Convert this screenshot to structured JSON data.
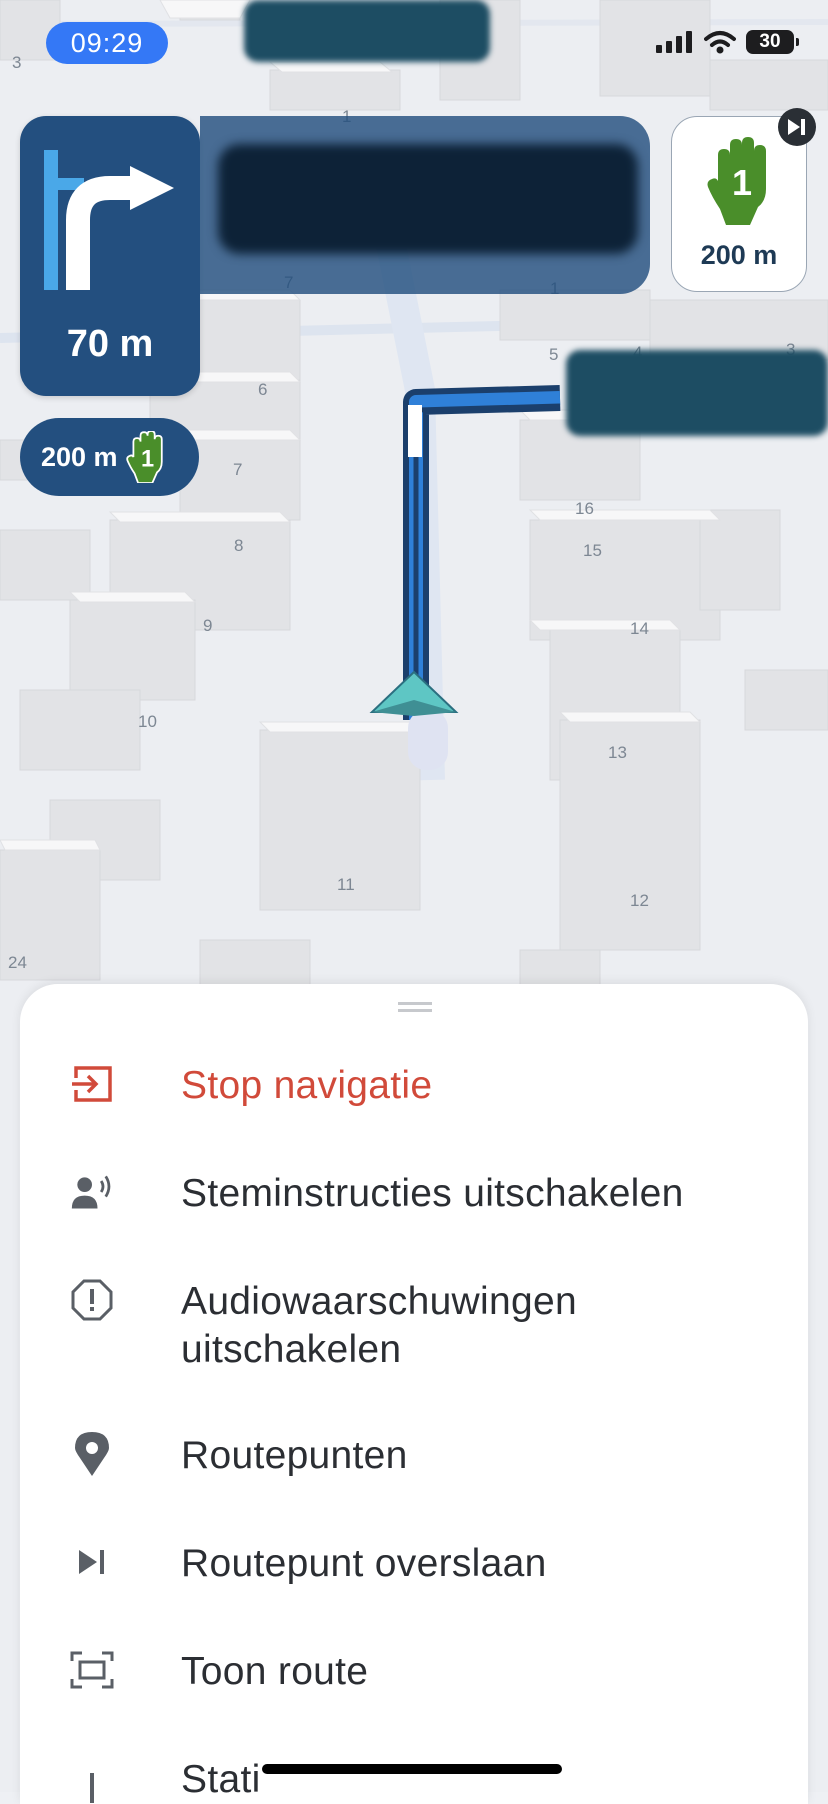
{
  "status_bar": {
    "time": "09:29",
    "battery": "30"
  },
  "navigation": {
    "turn_distance": "70 m",
    "sign_distance": "200 m",
    "hand_distance": "200 m",
    "hand_sign_number": "1"
  },
  "map": {
    "building_numbers": [
      "3",
      "1",
      "7",
      "1",
      "5",
      "4",
      "3",
      "6",
      "7",
      "16",
      "15",
      "8",
      "9",
      "14",
      "10",
      "13",
      "11",
      "12",
      "24"
    ]
  },
  "menu": {
    "items": [
      {
        "label": "Stop navigatie",
        "icon": "exit-icon",
        "color": "#d14a3a"
      },
      {
        "label": "Steminstructies uitschakelen",
        "icon": "voice-icon",
        "color": "#2b2e33"
      },
      {
        "label": "Audiowaarschuwingen uitschakelen",
        "icon": "alert-icon",
        "color": "#2b2e33"
      },
      {
        "label": "Routepunten",
        "icon": "location-pin-icon",
        "color": "#2b2e33"
      },
      {
        "label": "Routepunt overslaan",
        "icon": "skip-next-icon",
        "color": "#2b2e33"
      },
      {
        "label": "Toon route",
        "icon": "fit-route-icon",
        "color": "#2b2e33"
      },
      {
        "label": "Stati",
        "icon": "statistics-icon",
        "color": "#2b2e33"
      }
    ]
  },
  "colors": {
    "accent_blue": "#3478f6",
    "nav_blue": "#234f7f",
    "sign_green": "#4a8e2a",
    "stop_red": "#d14a3a"
  }
}
